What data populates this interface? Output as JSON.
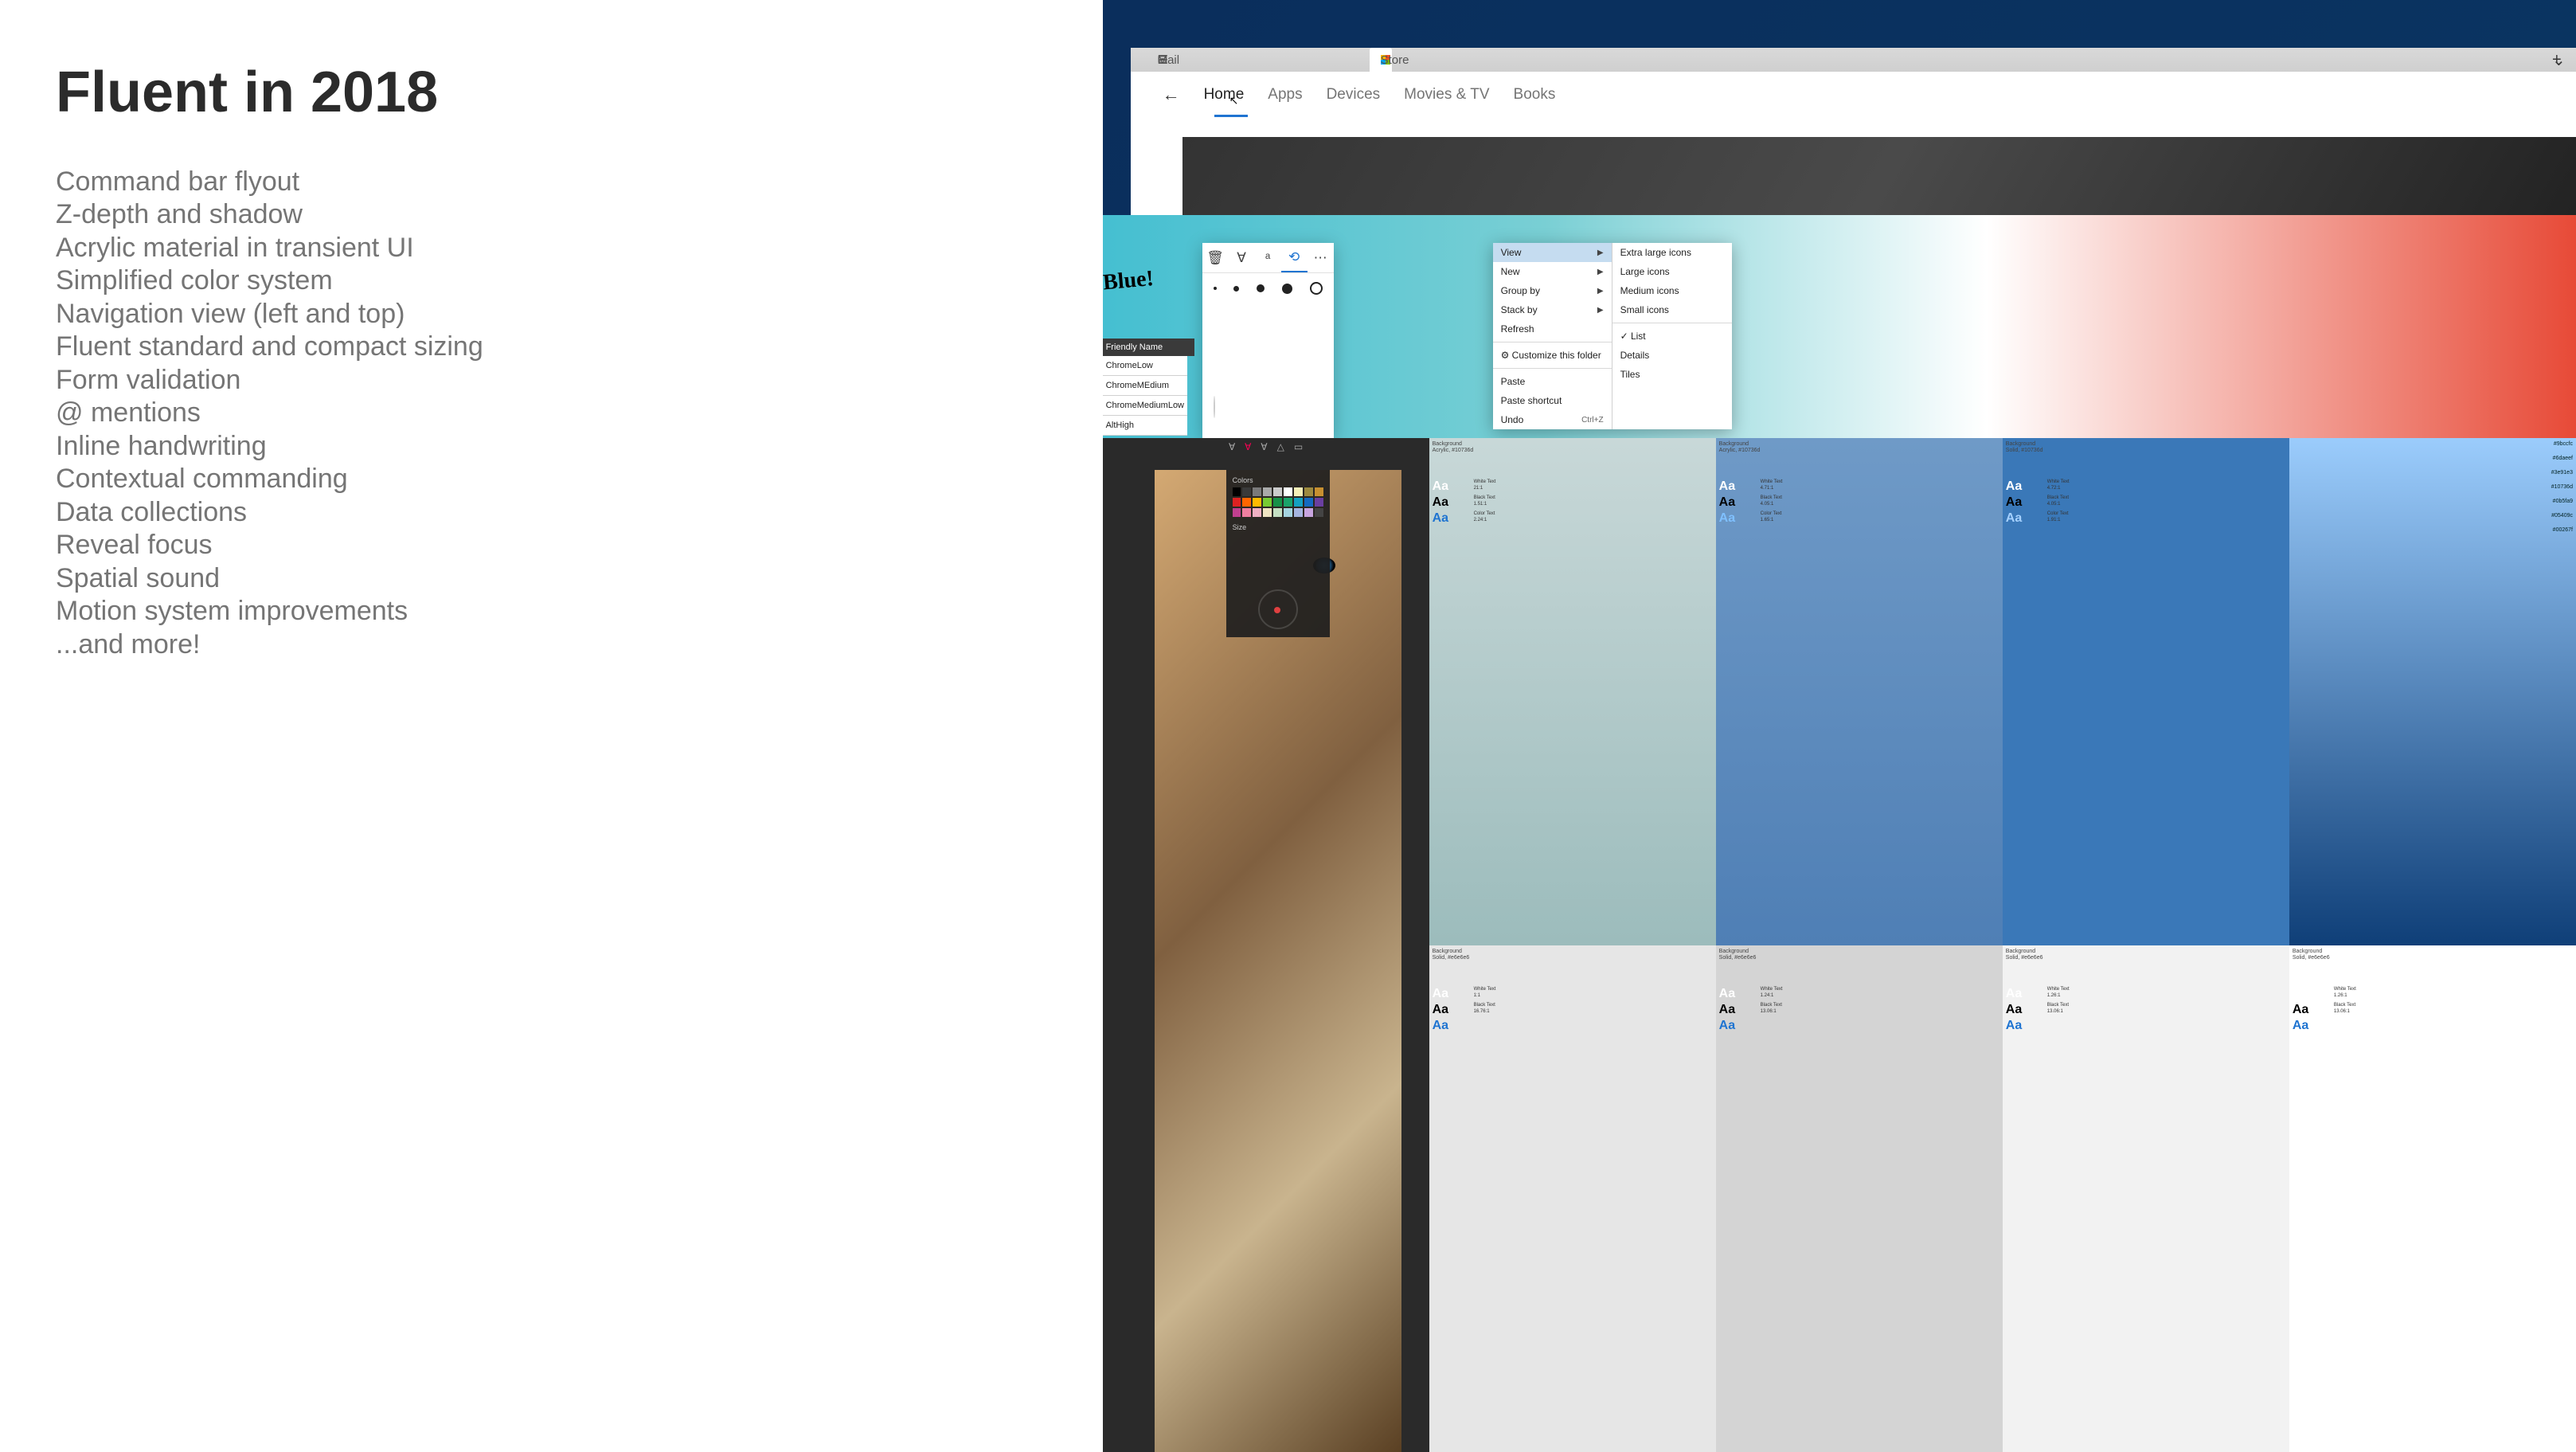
{
  "slide": {
    "title": "Fluent in 2018",
    "features": [
      "Command bar flyout",
      "Z-depth and shadow",
      "Acrylic material in transient UI",
      "Simplified color system",
      "Navigation view (left and top)",
      "Fluent standard and compact sizing",
      "Form validation",
      "@ mentions",
      "Inline handwriting",
      "Contextual commanding",
      "Data collections",
      "Reveal focus",
      "Spatial sound",
      "Motion system improvements",
      "...and more!"
    ]
  },
  "store_window": {
    "tab_mail": "Mail",
    "tab_store": "Store",
    "tab_new_icons": {
      "plus": "+",
      "chev": "⌄"
    },
    "nav": {
      "back": "←",
      "home": "Home",
      "apps": "Apps",
      "devices": "Devices",
      "movies": "Movies & TV",
      "books": "Books"
    }
  },
  "handwriting": "Blue!",
  "flyout_icons": {
    "trash": "🗑",
    "highlight": "∀",
    "text": "ᵃ",
    "transform": "⟲",
    "more": "⋯"
  },
  "thickness_levels": 5,
  "color_swatches": [
    [
      "#f2a100",
      "#e87300",
      "#e81f63",
      "#d61f1f"
    ],
    [
      "#6a2fa3",
      "#c040c0",
      "#d83fa3",
      "#1f4f9e"
    ],
    [
      "#1fa3d8",
      "#40bfe8",
      "#0f9d3f",
      "#7ed321"
    ],
    [
      "#222222",
      "#3d3d3d",
      "#b0b0b0",
      "#ffffff"
    ]
  ],
  "friendly_table": {
    "header": "Friendly Name",
    "rows": [
      "ChromeLow",
      "ChromeMEdium",
      "ChromeMediumLow",
      "AltHigh"
    ]
  },
  "ctx_menu": {
    "col1": [
      {
        "label": "View",
        "sub": true,
        "sel": true
      },
      {
        "label": "New",
        "sub": true
      },
      {
        "label": "Group by",
        "sub": true
      },
      {
        "label": "Stack by",
        "sub": true
      },
      {
        "label": "Refresh"
      },
      {
        "sep": true
      },
      {
        "label": "Customize this folder",
        "icon": "⚙"
      },
      {
        "sep": true
      },
      {
        "label": "Paste"
      },
      {
        "label": "Paste shortcut"
      },
      {
        "label": "Undo",
        "shortcut": "Ctrl+Z"
      }
    ],
    "col2": [
      {
        "label": "Extra large icons"
      },
      {
        "label": "Large icons"
      },
      {
        "label": "Medium icons"
      },
      {
        "label": "Small icons"
      },
      {
        "sep": true
      },
      {
        "label": "List",
        "icon": "✓"
      },
      {
        "label": "Details"
      },
      {
        "label": "Tiles"
      }
    ]
  },
  "editor": {
    "tools": [
      "∀",
      "∀",
      "∀",
      "△",
      "▭"
    ],
    "panel_title": "Colors",
    "size_label": "Size",
    "grid_colors": [
      "#000",
      "#3a3a3a",
      "#7a7a7a",
      "#aaa",
      "#ccc",
      "#fff",
      "#f5efb8",
      "#9d8a3f",
      "#c79030",
      "#d22",
      "#f60",
      "#fb0",
      "#7c3",
      "#169148",
      "#1aa36a",
      "#14a0c0",
      "#1469c0",
      "#6a3fa0",
      "#c03f8f",
      "#f07fa0",
      "#f0b0c3",
      "#f0e4c3",
      "#c5e0c3",
      "#a5d5e0",
      "#a5b5e0",
      "#c8a5e0",
      "#444"
    ]
  },
  "tiles": [
    {
      "hdr1": "Background",
      "hdr2": "Acrylic, #10736d",
      "bg": "linear-gradient(#c8d8d8,#9cbcbc)",
      "aa": [
        "#fff",
        "#000",
        "#1f74d1"
      ],
      "meta": [
        "White Text",
        "21:1",
        "Black Text",
        "1.51:1",
        "Color Text",
        "2.24:1"
      ]
    },
    {
      "hdr1": "Background",
      "hdr2": "Acrylic, #10736d",
      "bg": "linear-gradient(#6f9ac7,#4f7fb5)",
      "aa": [
        "#fff",
        "#000",
        "#7fc0ff"
      ],
      "meta": [
        "White Text",
        "4.71:1",
        "Black Text",
        "4.05:1",
        "Color Text",
        "1.65:1"
      ]
    },
    {
      "hdr1": "Background",
      "hdr2": "Solid, #10736d",
      "bg": "#3a78b8",
      "aa": [
        "#fff",
        "#000",
        "#a5d1ff"
      ],
      "meta": [
        "White Text",
        "4.72:1",
        "Black Text",
        "4.05:1",
        "Color Text",
        "1.91:1"
      ]
    },
    {
      "hdr1": "",
      "hdr2": "",
      "bg": "linear-gradient(#9bccfc,#0f3f78)",
      "meta_right": [
        "#9bccfc",
        "#6daeef",
        "#3e91e3",
        "#10736d",
        "#0b5fa9",
        "#05409c",
        "#00267f"
      ]
    },
    {
      "hdr1": "Background",
      "hdr2": "Solid, #e6e6e6",
      "bg": "#e6e6e6",
      "aa": [
        "#fff",
        "#000",
        "#1f74d1"
      ],
      "meta": [
        "White Text",
        "1:1",
        "Black Text",
        "16.76:1"
      ]
    },
    {
      "hdr1": "Background",
      "hdr2": "Solid, #e6e6e6",
      "bg": "#d4d4d4",
      "aa": [
        "#fff",
        "#000",
        "#1f74d1"
      ],
      "meta": [
        "White Text",
        "1.24:1",
        "Black Text",
        "13.06:1"
      ]
    },
    {
      "hdr1": "Background",
      "hdr2": "Solid, #e6e6e6",
      "bg": "#f2f2f2",
      "aa": [
        "#fff",
        "#000",
        "#1f74d1"
      ],
      "meta": [
        "White Text",
        "1.26:1",
        "Black Text",
        "13.06:1"
      ]
    },
    {
      "hdr1": "Background",
      "hdr2": "Solid, #e6e6e6",
      "bg": "#ffffff",
      "aa": [
        "#fff",
        "#000",
        "#1f74d1"
      ],
      "meta": [
        "White Text",
        "1.26:1",
        "Black Text",
        "13.06:1"
      ]
    }
  ]
}
